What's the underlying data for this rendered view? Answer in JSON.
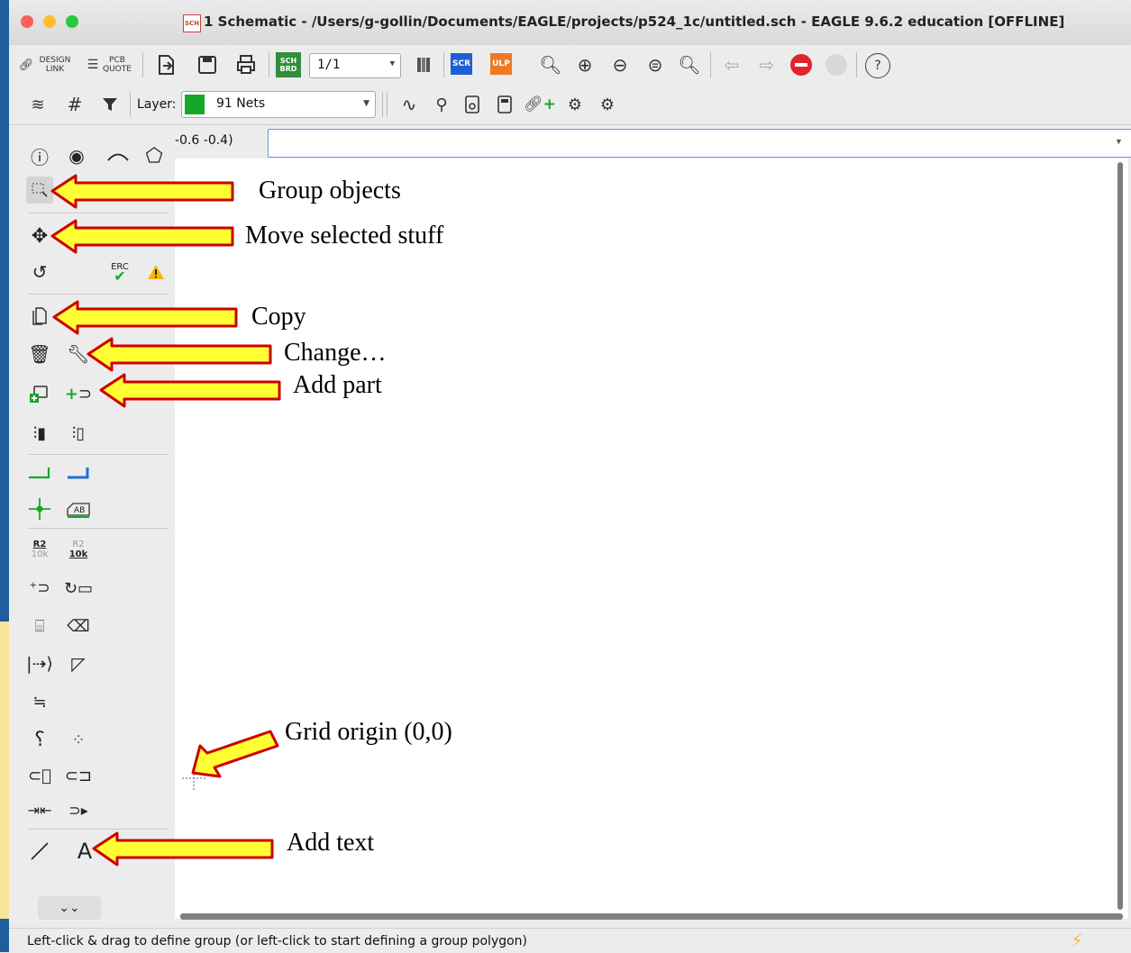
{
  "window": {
    "title": "1 Schematic - /Users/g-gollin/Documents/EAGLE/projects/p524_1c/untitled.sch - EAGLE 9.6.2 education [OFFLINE]",
    "title_icon": "SCH",
    "traffic_colors": [
      "#fe5f57",
      "#febc2e",
      "#28c840"
    ]
  },
  "toolbar1": {
    "design_link": "DESIGN LINK",
    "pcb_quote": "PCB QUOTE",
    "sch_brd": "SCH BRD",
    "sheet_select": "1/1",
    "scr_label": "SCR",
    "ulp_label": "ULP",
    "help_label": "?"
  },
  "toolbar2": {
    "layer_label": "Layer:",
    "layer_value": "91 Nets",
    "layer_color": "#14a829"
  },
  "coordinates": "-0.6 -0.4)",
  "command_input": "",
  "palette": {
    "erc_label": "ERC",
    "text_tool_label": "A",
    "value_label_top": "R2",
    "value_label_bottom": "10k",
    "text_frame_label": "AB"
  },
  "annotations": {
    "group": "Group objects",
    "move": "Move  selected  stuff",
    "copy": "Copy",
    "change": "Change…",
    "add_part": "Add part",
    "grid_origin": "Grid origin (0,0)",
    "add_text": "Add text",
    "arrow_fill": "#ffff33",
    "arrow_stroke": "#cc0000"
  },
  "status": {
    "message": "Left-click & drag to define group (or left-click to start defining a group polygon)"
  }
}
